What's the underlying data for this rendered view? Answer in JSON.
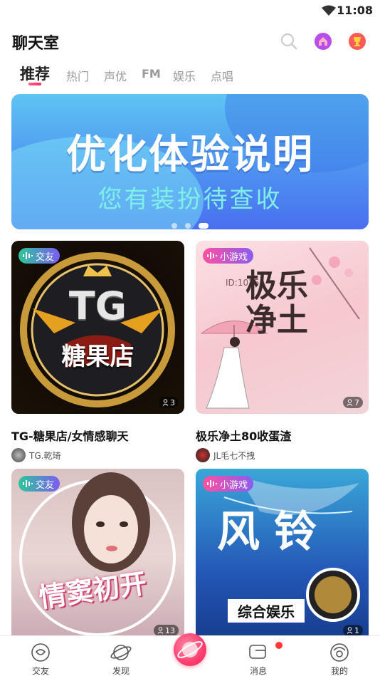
{
  "status_bar": {
    "time": "11:08"
  },
  "header": {
    "title": "聊天室"
  },
  "tabs": [
    {
      "label": "推荐",
      "active": true
    },
    {
      "label": "热门"
    },
    {
      "label": "声优"
    },
    {
      "label": "FM"
    },
    {
      "label": "娱乐"
    },
    {
      "label": "点唱"
    }
  ],
  "banner": {
    "title": "优化体验说明",
    "subtitle": "您有装扮待查收",
    "page_count": 3,
    "active_page": 3
  },
  "rooms": [
    {
      "tag": "交友",
      "title": "TG-糖果店/女情感聊天",
      "owner": "TG.乾琦",
      "count": "3",
      "cover_text": "TG",
      "cover_sub": "糖果店"
    },
    {
      "tag": "小游戏",
      "title": "极乐净土80收蛋渣",
      "owner": "JL毛七不拽",
      "count": "7",
      "cover_text": "极乐净土",
      "cover_id": "ID:10154"
    },
    {
      "tag": "交友",
      "title": "",
      "owner": "",
      "count": "13",
      "cover_text": "情窦初开"
    },
    {
      "tag": "小游戏",
      "title": "",
      "owner": "",
      "count": "1",
      "cover_text": "风铃",
      "cover_sub": "综合娱乐"
    }
  ],
  "bottom_nav": [
    {
      "label": "交友"
    },
    {
      "label": "发现"
    },
    {
      "label": ""
    },
    {
      "label": "消息",
      "has_dot": true
    },
    {
      "label": "我的"
    }
  ],
  "colors": {
    "accent": "#ff2e63",
    "banner_top": "#5ec4f2",
    "banner_bottom": "#4a6ff0"
  }
}
